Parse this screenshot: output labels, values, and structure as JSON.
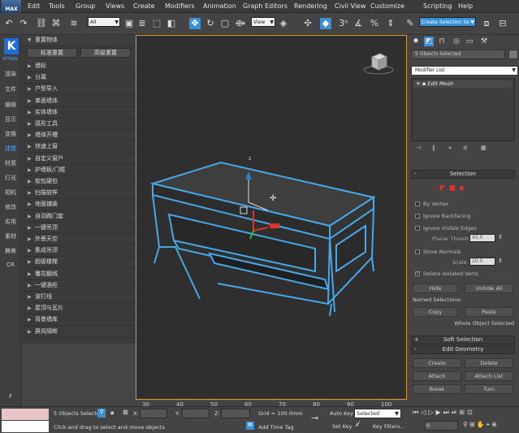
{
  "app": {
    "logo": "MAX"
  },
  "menu": [
    "Edit",
    "Tools",
    "Group",
    "Views",
    "Create",
    "Modifiers",
    "Animation",
    "Graph Editors",
    "Rendering",
    "Civil View",
    "Customize",
    "Scripting",
    "Help"
  ],
  "toolbar": {
    "selection_filter": "All",
    "ref_coord": "View",
    "named_selection": "Create Selection Se",
    "snap_label": "3"
  },
  "rail": {
    "logo": "K",
    "sub": "KITOOL",
    "items": [
      "渲染",
      "文件",
      "编辑",
      "显示",
      "变换",
      "建模",
      "材质",
      "灯光",
      "相机",
      "修改",
      "实用",
      "素材",
      "舞美",
      "CR"
    ],
    "footer": "F",
    "active_index": 5
  },
  "plugin": {
    "header": "重置物体",
    "buttons": [
      "标准重置",
      "高级重置"
    ],
    "items": [
      "墙标",
      "分离",
      "户型导入",
      "单面墙体",
      "实体墙体",
      "弧形工具",
      "墙体开槽",
      "快速上窗",
      "自定义窗户",
      "护墙板/门框",
      "软包硬包",
      "扫描放样",
      "地面铺装",
      "自动踢门套",
      "一键吊顶",
      "外景天空",
      "集成吊顶",
      "超级楼梯",
      "覆花翻线",
      "一键酒柜",
      "波打线",
      "屋顶与瓦片",
      "背景墙库",
      "屏风隔断"
    ]
  },
  "viewport": {
    "axis_label": "z",
    "ruler_ticks": [
      "30",
      "40",
      "50",
      "60",
      "70",
      "80",
      "90",
      "100"
    ]
  },
  "command": {
    "objects_selected": "5 Objects Selected",
    "modifier_list": "Modifier List",
    "stack_item": "Edit Mesh",
    "selection_title": "Selection",
    "checks": {
      "by_vertex": "By Vertex",
      "ignore_backfacing": "Ignore Backfacing",
      "ignore_visible_edges": "Ignore Visible Edges",
      "show_normals": "Show Normals",
      "delete_isolated": "Delete Isolated Verts"
    },
    "planar_thresh_label": "Planar Thresh:",
    "planar_thresh": "45.0",
    "scale_label": "Scale:",
    "scale": "20.0",
    "hide": "Hide",
    "unhide_all": "Unhide All",
    "named_selections": "Named Selections:",
    "copy": "Copy",
    "paste": "Paste",
    "whole_object": "Whole Object Selected",
    "soft_selection": "Soft Selection",
    "edit_geometry": "Edit Geometry",
    "create": "Create",
    "delete": "Delete",
    "attach": "Attach",
    "attach_list": "Attach List",
    "break": "Break",
    "turn": "Turn"
  },
  "status": {
    "objects_selected": "5 Objects Selecte",
    "x_label": "X:",
    "y_label": "Y:",
    "z_label": "Z:",
    "grid": "Grid = 100.0mm",
    "auto_key": "Auto Key",
    "selected": "Selected",
    "set_key": "Set Key",
    "key_filters": "Key Filters...",
    "prompt": "Click and drag to select and move objects",
    "add_time_tag": "Add Time Tag",
    "frame": "0"
  }
}
